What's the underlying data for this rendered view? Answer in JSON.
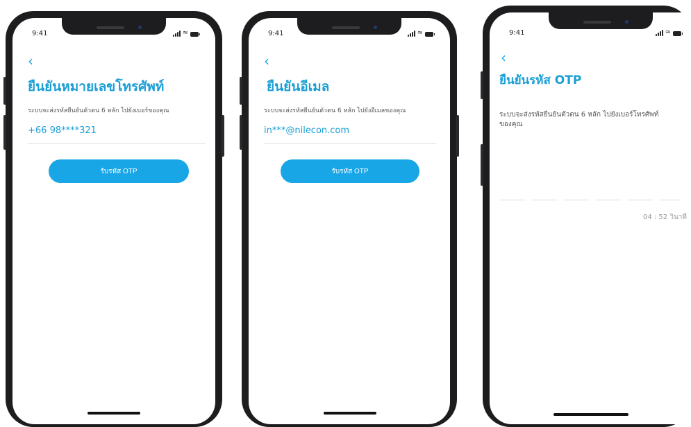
{
  "status_bar": {
    "time": "9:41"
  },
  "screens": [
    {
      "title": "ยืนยันหมายเลขโทรศัพท์",
      "description": "ระบบจะส่งรหัสยืนยันตัวตน 6 หลัก ไปยังเบอร์ของคุณ",
      "value": "+66 98****321",
      "button_label": "รับรหัส OTP"
    },
    {
      "title": "ยืนยันอีเมล",
      "description": "ระบบจะส่งรหัสยืนยันตัวตน 6 หลัก ไปยังอีเมลของคุณ",
      "value": "in***@nilecon.com",
      "button_label": "รับรหัส OTP"
    },
    {
      "title": "ยืนยันรหัส OTP",
      "description": "ระบบจะส่งรหัสยืนยันตัวตน 6 หลัก ไปยังเบอร์โทรศัพท์ของคุณ",
      "otp_digits": [
        "",
        "",
        "",
        "",
        "",
        ""
      ],
      "timer": "04 : 52  วินาที"
    }
  ],
  "icons": {
    "back": "chevron-left-icon",
    "signal": "signal-icon",
    "wifi": "wifi-icon",
    "battery": "battery-icon"
  },
  "colors": {
    "accent": "#1a9fd6",
    "button": "#19a6e6",
    "phone_frame": "#1d1d1f"
  }
}
